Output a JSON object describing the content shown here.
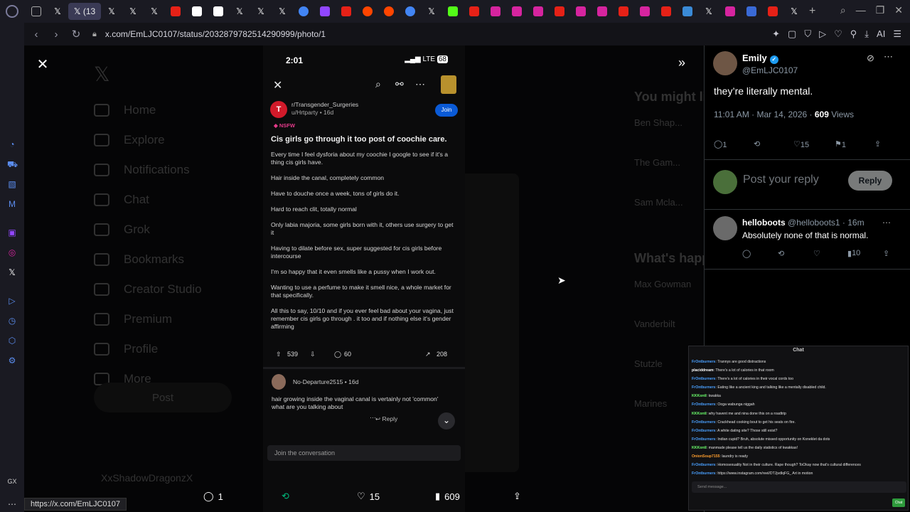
{
  "browser": {
    "address": "x.com/EmLJC0107/status/2032879782514290999/photo/1",
    "active_tab_label": "(13",
    "status_link": "https://x.com/EmLJC0107"
  },
  "reddit_post": {
    "phone_time": "2:01",
    "phone_signal": "LTE",
    "phone_battery": "68",
    "subreddit": "r/Transgender_Surgeries",
    "user": "u/Hrtparty",
    "age": "16d",
    "join_label": "Join",
    "nsfw_label": "NSFW",
    "title": "Cis girls go through it too post of coochie care.",
    "paragraphs": [
      "Every time I feel dysforia about my coochie I google to see if it's a thing cis girls have.",
      "Hair inside the canal, completely common",
      "Have to douche once a week, tons of girls do it.",
      "Hard to reach clit, totally normal",
      "Only labia majoria, some girls born with it, others use surgery to get it",
      "Having to dilate before sex, super suggested for cis girls before intercourse",
      "I'm so happy that it even smells like a pussy when I work out.",
      "Wanting to use a perfume to make it smell nice, a whole market for that specifically.",
      "All this to say, 10/10 and if you ever feel bad about your vagina, just remember cis girls go through . it too and if nothing else it's gender affirming"
    ],
    "upvotes": "539",
    "comments": "60",
    "shares": "208",
    "comment_user": "No-Departure2515",
    "comment_age": "16d",
    "comment_text": "hair growing inside the vaginal canal is vertainly not 'common' what are you talking about",
    "comment_reply": "Reply",
    "join_conversation": "Join the conversation"
  },
  "bottom_bar": {
    "replies": "1",
    "likes": "15",
    "views": "609"
  },
  "tweet": {
    "name": "Emily",
    "handle": "@EmLJC0107",
    "text": "they’re literally mental.",
    "time": "11:01 AM · Mar 14, 2026 · ",
    "views_count": "609",
    "views_label": " Views",
    "reply_count": "1",
    "like_count": "15",
    "bookmark_count": "1",
    "reply_placeholder": "Post your reply",
    "reply_button": "Reply"
  },
  "reply_tweet": {
    "name": "helloboots",
    "handle": "@helloboots1 · 16m",
    "text": "Absolutely none of that is normal.",
    "views": "10"
  },
  "background_nav": [
    "Home",
    "Explore",
    "Notifications",
    "Chat",
    "Grok",
    "Bookmarks",
    "Creator Studio",
    "Premium",
    "Profile",
    "More"
  ],
  "background_post_button": "Post",
  "background_user": "XxShadowDragonzX",
  "background_right": {
    "heading": "You might like",
    "rows": [
      "Ben Shap...",
      "The Gam...",
      "Sam Mcla..."
    ],
    "heading2": "What's happ...",
    "rows2": [
      "Max Gowman",
      "Vanderbilt",
      "Stutzle",
      "Marines"
    ]
  },
  "chat": {
    "title": "Chat",
    "send_placeholder": "Send message...",
    "send_button": "Chat",
    "messages": [
      {
        "user": "FrOntburners",
        "text": "Trannys are good distractions"
      },
      {
        "user": "placiddream",
        "text": "There's a lot of calories in that room"
      },
      {
        "user": "FrOntburners",
        "text": "There's a lot of calories in their vocal cords too"
      },
      {
        "user": "FrOntburners",
        "text": "Eating like a ancient king and talking like a mentally disabled child."
      },
      {
        "user": "KKKontI",
        "text": "kwakka"
      },
      {
        "user": "FrOntburners",
        "text": "Ooga wabunga niggah"
      },
      {
        "user": "KKKontI",
        "text": "why havent me and nina done this on a roadtrip"
      },
      {
        "user": "FrOntburners",
        "text": "Crackhead cooking bout to get his seats on fire."
      },
      {
        "user": "FrOntburners",
        "text": "A white dating site? Those still exist?"
      },
      {
        "user": "FrOntburners",
        "text": "Indian cupid? Bruh, absolute missed opportunity on Koneklet da dots"
      },
      {
        "user": "KKKontI",
        "text": "manmade please tell us the daily statistics of kwakkas!"
      },
      {
        "user": "OnionSoup7155",
        "text": "laundry is ready"
      },
      {
        "user": "FrOntburners",
        "text": "Homosexuality Not in their culture. Rape though? ToOkay now that's cultural differences"
      },
      {
        "user": "FrOntburners",
        "text": "https://www.instagram.com/reel/DTJjvdlqFG_ Art in motion"
      }
    ]
  }
}
